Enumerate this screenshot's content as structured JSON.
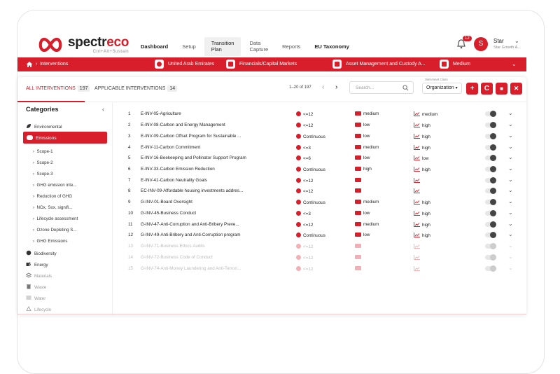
{
  "brand": {
    "name_part1": "spectr",
    "name_part2": "eco",
    "tagline": "Ctrl+Alt+Sustain",
    "accent": "#d81e2a"
  },
  "nav": {
    "dashboard": "Dashboard",
    "setup": "Setup",
    "transition_plan_1": "Transition",
    "transition_plan_2": "Plan",
    "data_capture_1": "Data",
    "data_capture_2": "Capture",
    "reports": "Reports",
    "eu_taxonomy": "EU Taxonomy"
  },
  "header": {
    "notifications": "12",
    "avatar_letter": "S",
    "user_name": "Star",
    "user_org": "Star Growth A..."
  },
  "context_bar": {
    "breadcrumb": "Interventions",
    "country": "United Arab Emirates",
    "sector": "Financials/Capital Markets",
    "industry": "Asset Management and Custody A...",
    "size": "Medium"
  },
  "toolbar": {
    "tab_all": "ALL INTERVENTIONS",
    "tab_all_count": "197",
    "tab_applicable": "APPLICABLE INTERVENTIONS",
    "tab_applicable_count": "14",
    "pager": "1–20 of 197",
    "prev": "‹",
    "next": "›",
    "search_placeholder": "Search...",
    "org_label": "Site/Asset Class",
    "org_value": "Organization",
    "add": "+",
    "refresh": "C",
    "save": "■",
    "magic": "✕"
  },
  "sidebar": {
    "title": "Categories",
    "collapse": "‹",
    "environmental": "Environmental",
    "emissions": "Emissions",
    "sub_items": [
      "Scope-1",
      "Scope-2",
      "Scope-3",
      "GHG emission inte...",
      "Reduction of GHG",
      "NOx, Sox, signifi...",
      "Lifecycle assessment",
      "Ozone Depleting S...",
      "GHG Emissions"
    ],
    "categories": [
      "Biodiversity",
      "Energy",
      "Materials",
      "Waste",
      "Water",
      "Lifecycle"
    ]
  },
  "rows": [
    {
      "num": "1",
      "name": "E-INV-05-Agriculture",
      "time": "<=12",
      "impact": "medium",
      "effort": "medium"
    },
    {
      "num": "2",
      "name": "E-INV-08-Carbon and Energy Management",
      "time": "<=12",
      "impact": "low",
      "effort": "high"
    },
    {
      "num": "3",
      "name": "E-INV-09-Carbon Offset Program for Sustainable ...",
      "time": "Continuous",
      "impact": "low",
      "effort": "high"
    },
    {
      "num": "4",
      "name": "E-INV-11-Carbon Commitment",
      "time": "<=3",
      "impact": "medium",
      "effort": "high"
    },
    {
      "num": "5",
      "name": "E-INV-16-Beekeeping and Pollinator Support Program",
      "time": "<=6",
      "impact": "low",
      "effort": "low"
    },
    {
      "num": "6",
      "name": "E-INV-33-Carbon Emission Reduction",
      "time": "Continuous",
      "impact": "high",
      "effort": "high"
    },
    {
      "num": "7",
      "name": "E-INV-41-Carbon Neutrality Goals",
      "time": "<=12",
      "impact": "",
      "effort": ""
    },
    {
      "num": "8",
      "name": "EC-INV-09-Affordable housing investments addres...",
      "time": "<=12",
      "impact": "",
      "effort": ""
    },
    {
      "num": "9",
      "name": "G-INV-01-Board Oversight",
      "time": "Continuous",
      "impact": "medium",
      "effort": "high"
    },
    {
      "num": "10",
      "name": "G-INV-45-Business Conduct",
      "time": "<=3",
      "impact": "low",
      "effort": "high"
    },
    {
      "num": "11",
      "name": "G-INV-47-Anti-Corruption and Anti-Bribery Preve...",
      "time": "<=12",
      "impact": "medium",
      "effort": "high"
    },
    {
      "num": "12",
      "name": "G-INV-49-Anti-Bribery and Anti-Corruption program",
      "time": "Continuous",
      "impact": "low",
      "effort": "high"
    },
    {
      "num": "13",
      "name": "G-INV-71-Business Ethics Audits",
      "time": "<=12",
      "impact": "",
      "effort": ""
    },
    {
      "num": "14",
      "name": "G-INV-72-Business Code of Conduct",
      "time": "<=12",
      "impact": "",
      "effort": ""
    },
    {
      "num": "15",
      "name": "G-INV-74-Anti-Money Laundering and Anti-Terrori...",
      "time": "<=12",
      "impact": "",
      "effort": ""
    }
  ]
}
